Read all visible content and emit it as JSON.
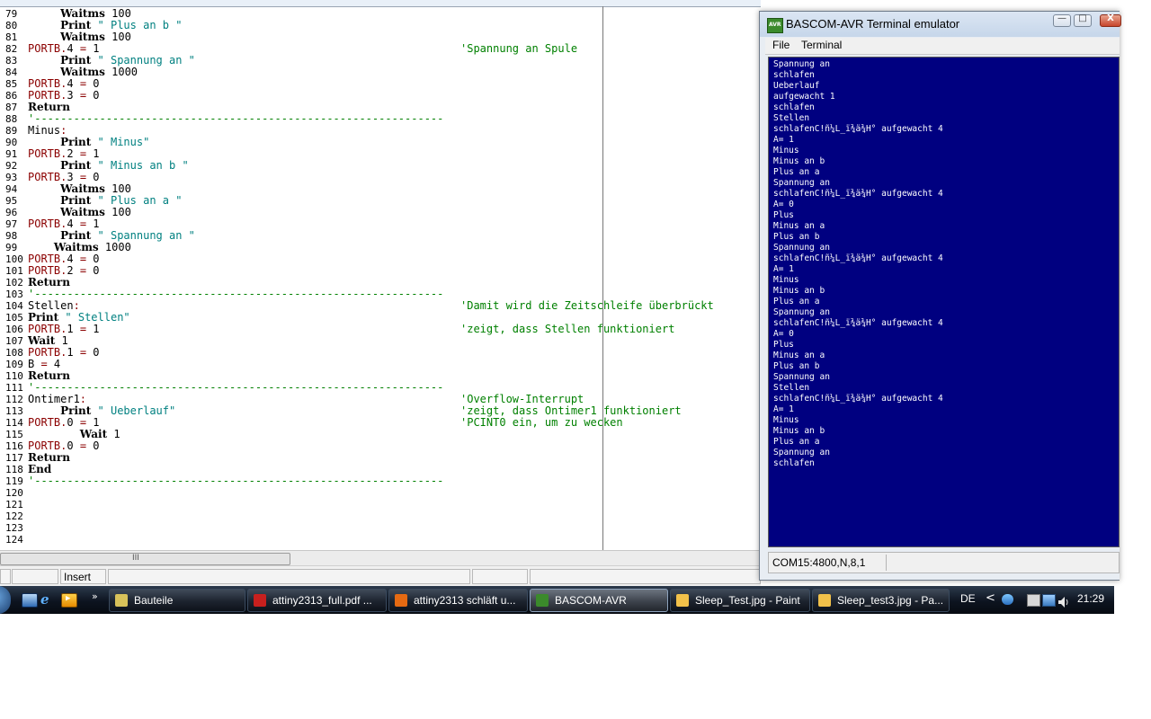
{
  "editor": {
    "code_lines": [
      {
        "n": "79",
        "segs": [
          [
            "ind",
            "     "
          ],
          [
            "kw",
            "Waitms"
          ],
          [
            "num",
            " 100"
          ]
        ],
        "comment": ""
      },
      {
        "n": "80",
        "segs": [
          [
            "ind",
            "     "
          ],
          [
            "kw",
            "Print"
          ],
          [
            "str",
            " \" Plus an b \""
          ]
        ],
        "comment": ""
      },
      {
        "n": "81",
        "segs": [
          [
            "ind",
            "     "
          ],
          [
            "kw",
            "Waitms"
          ],
          [
            "num",
            " 100"
          ]
        ],
        "comment": ""
      },
      {
        "n": "82",
        "segs": [
          [
            "port",
            "PORTB"
          ],
          [
            "op",
            "."
          ],
          [
            "num",
            "4"
          ],
          [
            "op",
            " = "
          ],
          [
            "num",
            "1"
          ]
        ],
        "comment": "'Spannung an Spule"
      },
      {
        "n": "83",
        "segs": [
          [
            "ind",
            "     "
          ],
          [
            "kw",
            "Print"
          ],
          [
            "str",
            " \" Spannung an \""
          ]
        ],
        "comment": ""
      },
      {
        "n": "84",
        "segs": [
          [
            "ind",
            "     "
          ],
          [
            "kw",
            "Waitms"
          ],
          [
            "num",
            " 1000"
          ]
        ],
        "comment": ""
      },
      {
        "n": "85",
        "segs": [
          [
            "port",
            "PORTB"
          ],
          [
            "op",
            "."
          ],
          [
            "num",
            "4"
          ],
          [
            "op",
            " = "
          ],
          [
            "num",
            "0"
          ]
        ],
        "comment": ""
      },
      {
        "n": "86",
        "segs": [
          [
            "port",
            "PORTB"
          ],
          [
            "op",
            "."
          ],
          [
            "num",
            "3"
          ],
          [
            "op",
            " = "
          ],
          [
            "num",
            "0"
          ]
        ],
        "comment": ""
      },
      {
        "n": "87",
        "segs": [
          [
            "kw",
            "Return"
          ]
        ],
        "comment": ""
      },
      {
        "n": "88",
        "segs": [
          [
            "sep",
            "'---------------------------------------------------------------"
          ]
        ],
        "comment": ""
      },
      {
        "n": "89",
        "segs": [
          [
            "lbl",
            "Minus"
          ],
          [
            "colon",
            ":"
          ]
        ],
        "comment": ""
      },
      {
        "n": "90",
        "segs": [
          [
            "ind",
            "     "
          ],
          [
            "kw",
            "Print"
          ],
          [
            "str",
            " \" Minus\""
          ]
        ],
        "comment": ""
      },
      {
        "n": "91",
        "segs": [
          [
            "port",
            "PORTB"
          ],
          [
            "op",
            "."
          ],
          [
            "num",
            "2"
          ],
          [
            "op",
            " = "
          ],
          [
            "num",
            "1"
          ]
        ],
        "comment": ""
      },
      {
        "n": "92",
        "segs": [
          [
            "ind",
            "     "
          ],
          [
            "kw",
            "Print"
          ],
          [
            "str",
            " \" Minus an b \""
          ]
        ],
        "comment": ""
      },
      {
        "n": "93",
        "segs": [
          [
            "port",
            "PORTB"
          ],
          [
            "op",
            "."
          ],
          [
            "num",
            "3"
          ],
          [
            "op",
            " = "
          ],
          [
            "num",
            "0"
          ]
        ],
        "comment": ""
      },
      {
        "n": "94",
        "segs": [
          [
            "ind",
            "     "
          ],
          [
            "kw",
            "Waitms"
          ],
          [
            "num",
            " 100"
          ]
        ],
        "comment": ""
      },
      {
        "n": "95",
        "segs": [
          [
            "ind",
            "     "
          ],
          [
            "kw",
            "Print"
          ],
          [
            "str",
            " \" Plus an a \""
          ]
        ],
        "comment": ""
      },
      {
        "n": "96",
        "segs": [
          [
            "ind",
            "     "
          ],
          [
            "kw",
            "Waitms"
          ],
          [
            "num",
            " 100"
          ]
        ],
        "comment": ""
      },
      {
        "n": "97",
        "segs": [
          [
            "port",
            "PORTB"
          ],
          [
            "op",
            "."
          ],
          [
            "num",
            "4"
          ],
          [
            "op",
            " = "
          ],
          [
            "num",
            "1"
          ]
        ],
        "comment": ""
      },
      {
        "n": "98",
        "segs": [
          [
            "ind",
            "     "
          ],
          [
            "kw",
            "Print"
          ],
          [
            "str",
            " \" Spannung an \""
          ]
        ],
        "comment": ""
      },
      {
        "n": "99",
        "segs": [
          [
            "ind",
            "    "
          ],
          [
            "kw",
            "Waitms"
          ],
          [
            "num",
            " 1000"
          ]
        ],
        "comment": ""
      },
      {
        "n": "100",
        "segs": [
          [
            "port",
            "PORTB"
          ],
          [
            "op",
            "."
          ],
          [
            "num",
            "4"
          ],
          [
            "op",
            " = "
          ],
          [
            "num",
            "0"
          ]
        ],
        "comment": ""
      },
      {
        "n": "101",
        "segs": [
          [
            "port",
            "PORTB"
          ],
          [
            "op",
            "."
          ],
          [
            "num",
            "2"
          ],
          [
            "op",
            " = "
          ],
          [
            "num",
            "0"
          ]
        ],
        "comment": ""
      },
      {
        "n": "102",
        "segs": [
          [
            "kw",
            "Return"
          ]
        ],
        "comment": ""
      },
      {
        "n": "103",
        "segs": [
          [
            "sep",
            "'---------------------------------------------------------------"
          ]
        ],
        "comment": ""
      },
      {
        "n": "104",
        "segs": [
          [
            "lbl",
            "Stellen"
          ],
          [
            "colon",
            ":"
          ]
        ],
        "comment": "'Damit wird die Zeitschleife überbrückt"
      },
      {
        "n": "105",
        "segs": [
          [
            "kw",
            "Print"
          ],
          [
            "str",
            " \" Stellen\""
          ]
        ],
        "comment": ""
      },
      {
        "n": "106",
        "segs": [
          [
            "port",
            "PORTB"
          ],
          [
            "op",
            "."
          ],
          [
            "num",
            "1"
          ],
          [
            "op",
            " = "
          ],
          [
            "num",
            "1"
          ]
        ],
        "comment": "'zeigt, dass Stellen funktioniert"
      },
      {
        "n": "107",
        "segs": [
          [
            "kw",
            "Wait"
          ],
          [
            "num",
            " 1"
          ]
        ],
        "comment": ""
      },
      {
        "n": "108",
        "segs": [
          [
            "port",
            "PORTB"
          ],
          [
            "op",
            "."
          ],
          [
            "num",
            "1"
          ],
          [
            "op",
            " = "
          ],
          [
            "num",
            "0"
          ]
        ],
        "comment": ""
      },
      {
        "n": "109",
        "segs": [
          [
            "lbl",
            "B"
          ],
          [
            "op",
            " = "
          ],
          [
            "num",
            "4"
          ]
        ],
        "comment": ""
      },
      {
        "n": "110",
        "segs": [
          [
            "kw",
            "Return"
          ]
        ],
        "comment": ""
      },
      {
        "n": "111",
        "segs": [
          [
            "sep",
            "'---------------------------------------------------------------"
          ]
        ],
        "comment": ""
      },
      {
        "n": "112",
        "segs": [
          [
            "lbl",
            "Ontimer1"
          ],
          [
            "colon",
            ":"
          ]
        ],
        "comment": "'Overflow-Interrupt"
      },
      {
        "n": "113",
        "segs": [
          [
            "ind",
            "     "
          ],
          [
            "kw",
            "Print"
          ],
          [
            "str",
            " \" Ueberlauf\""
          ]
        ],
        "comment": "'zeigt, dass Ontimer1 funktioniert"
      },
      {
        "n": "114",
        "segs": [
          [
            "port",
            "PORTB"
          ],
          [
            "op",
            "."
          ],
          [
            "num",
            "0"
          ],
          [
            "op",
            " = "
          ],
          [
            "num",
            "1"
          ]
        ],
        "comment": "'PCINT0 ein, um zu wecken"
      },
      {
        "n": "115",
        "segs": [
          [
            "ind",
            "        "
          ],
          [
            "kw",
            "Wait"
          ],
          [
            "num",
            " 1"
          ]
        ],
        "comment": ""
      },
      {
        "n": "116",
        "segs": [
          [
            "port",
            "PORTB"
          ],
          [
            "op",
            "."
          ],
          [
            "num",
            "0"
          ],
          [
            "op",
            " = "
          ],
          [
            "num",
            "0"
          ]
        ],
        "comment": ""
      },
      {
        "n": "117",
        "segs": [
          [
            "kw",
            "Return"
          ]
        ],
        "comment": ""
      },
      {
        "n": "118",
        "segs": [
          [
            "kw",
            "End"
          ]
        ],
        "comment": ""
      },
      {
        "n": "119",
        "segs": [
          [
            "sep",
            "'---------------------------------------------------------------"
          ]
        ],
        "comment": ""
      },
      {
        "n": "120",
        "segs": [],
        "comment": ""
      },
      {
        "n": "121",
        "segs": [],
        "comment": ""
      },
      {
        "n": "122",
        "segs": [],
        "comment": ""
      },
      {
        "n": "123",
        "segs": [],
        "comment": ""
      },
      {
        "n": "124",
        "segs": [],
        "comment": ""
      }
    ],
    "scroll_grip": "III",
    "status": {
      "mode": "Insert"
    }
  },
  "terminal": {
    "title": "BASCOM-AVR Terminal emulator",
    "app_icon_text": "AVR",
    "menu": {
      "file": "File",
      "terminal": "Terminal"
    },
    "window_buttons": {
      "minimize": "—",
      "maximize": "□",
      "close": "X"
    },
    "output_lines": [
      "Spannung an",
      "schlafen",
      "Ueberlauf",
      "aufgewacht 1",
      "schlafen",
      "Stellen",
      "schlafenC!ñ¼L_ï¾ä¾H° aufgewacht 4",
      "A= 1",
      "Minus",
      "Minus an b",
      "Plus an a",
      "Spannung an",
      "schlafenC!ñ¼L_ï¾ä¾H° aufgewacht 4",
      "A= 0",
      "Plus",
      "Minus an a",
      "Plus an b",
      "Spannung an",
      "schlafenC!ñ¼L_ï¾ä¾H° aufgewacht 4",
      "A= 1",
      "Minus",
      "Minus an b",
      "Plus an a",
      "Spannung an",
      "schlafenC!ñ¼L_ï¾ä¾H° aufgewacht 4",
      "A= 0",
      "Plus",
      "Minus an a",
      "Plus an b",
      "Spannung an",
      "Stellen",
      "schlafenC!ñ¼L_ï¾ä¾H° aufgewacht 4",
      "A= 1",
      "Minus",
      "Minus an b",
      "Plus an a",
      "Spannung an",
      "schlafen"
    ],
    "status": "COM15:4800,N,8,1",
    "screen_bg": "#000080",
    "screen_fg": "#ffffff"
  },
  "taskbar": {
    "quicklaunch_more": "»",
    "tasks": [
      {
        "label": "Bauteile",
        "icon": "folder-icon",
        "color": "#d9c25a",
        "active": false
      },
      {
        "label": "attiny2313_full.pdf ...",
        "icon": "pdf-icon",
        "color": "#c8201e",
        "active": false
      },
      {
        "label": "attiny2313 schläft u...",
        "icon": "firefox-icon",
        "color": "#e66a12",
        "active": false
      },
      {
        "label": "BASCOM-AVR",
        "icon": "bascom-icon",
        "color": "#3b8a2b",
        "active": true
      },
      {
        "label": "Sleep_Test.jpg - Paint",
        "icon": "paint-icon",
        "color": "#f2c14a",
        "active": false
      },
      {
        "label": "Sleep_test3.jpg - Pa...",
        "icon": "paint-icon",
        "color": "#f2c14a",
        "active": false
      }
    ],
    "tray": {
      "language": "DE",
      "chevron": "<",
      "clock": "21:29"
    }
  }
}
